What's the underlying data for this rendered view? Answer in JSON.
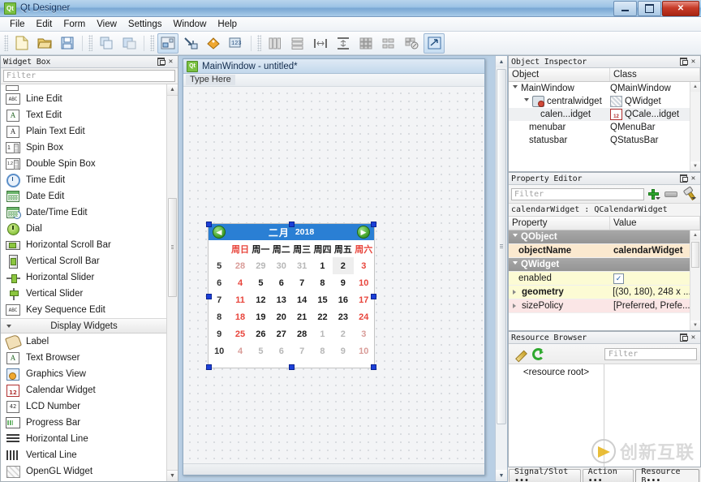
{
  "window": {
    "title": "Qt Designer",
    "logo_text": "Qt",
    "minimize_label": "",
    "maximize_label": "",
    "close_label": "✕"
  },
  "menubar": {
    "items": [
      {
        "label": "File"
      },
      {
        "label": "Edit"
      },
      {
        "label": "Form"
      },
      {
        "label": "View"
      },
      {
        "label": "Settings"
      },
      {
        "label": "Window"
      },
      {
        "label": "Help"
      }
    ]
  },
  "widget_box": {
    "title": "Widget Box",
    "filter_placeholder": "Filter",
    "items": [
      {
        "label": "Line Edit",
        "icon": "line-edit-icon"
      },
      {
        "label": "Text Edit",
        "icon": "text-edit-icon"
      },
      {
        "label": "Plain Text Edit",
        "icon": "plain-text-edit-icon"
      },
      {
        "label": "Spin Box",
        "icon": "spin-box-icon"
      },
      {
        "label": "Double Spin Box",
        "icon": "double-spin-box-icon"
      },
      {
        "label": "Time Edit",
        "icon": "time-edit-icon"
      },
      {
        "label": "Date Edit",
        "icon": "date-edit-icon"
      },
      {
        "label": "Date/Time Edit",
        "icon": "date-time-edit-icon"
      },
      {
        "label": "Dial",
        "icon": "dial-icon"
      },
      {
        "label": "Horizontal Scroll Bar",
        "icon": "horizontal-scroll-bar-icon"
      },
      {
        "label": "Vertical Scroll Bar",
        "icon": "vertical-scroll-bar-icon"
      },
      {
        "label": "Horizontal Slider",
        "icon": "horizontal-slider-icon"
      },
      {
        "label": "Vertical Slider",
        "icon": "vertical-slider-icon"
      },
      {
        "label": "Key Sequence Edit",
        "icon": "key-sequence-edit-icon"
      }
    ],
    "category": "Display Widgets",
    "display_items": [
      {
        "label": "Label",
        "icon": "label-icon"
      },
      {
        "label": "Text Browser",
        "icon": "text-browser-icon"
      },
      {
        "label": "Graphics View",
        "icon": "graphics-view-icon"
      },
      {
        "label": "Calendar Widget",
        "icon": "calendar-widget-icon"
      },
      {
        "label": "LCD Number",
        "icon": "lcd-number-icon"
      },
      {
        "label": "Progress Bar",
        "icon": "progress-bar-icon"
      },
      {
        "label": "Horizontal Line",
        "icon": "horizontal-line-icon"
      },
      {
        "label": "Vertical Line",
        "icon": "vertical-line-icon"
      },
      {
        "label": "OpenGL Widget",
        "icon": "opengl-widget-icon"
      }
    ],
    "icon_captions": {
      "line_edit": "ABC",
      "text_edit": "A",
      "plain_text_edit": "A",
      "spin_box": "1",
      "double_spin": "1.2",
      "key_seq": "ABC",
      "calendar": "12",
      "lcd": "42"
    }
  },
  "form": {
    "title": "MainWindow - untitled*",
    "logo_text": "Qt",
    "menu_placeholder": "Type Here"
  },
  "calendar": {
    "month": "二月",
    "year": "2018",
    "prev_label": "◀",
    "next_label": "▶",
    "weekdays": [
      "周日",
      "周一",
      "周二",
      "周三",
      "周四",
      "周五",
      "周六"
    ],
    "week_numbers": [
      "5",
      "6",
      "7",
      "8",
      "9",
      "10"
    ],
    "rows": [
      [
        {
          "d": "28",
          "s": "off"
        },
        {
          "d": "29",
          "s": "off"
        },
        {
          "d": "30",
          "s": "off"
        },
        {
          "d": "31",
          "s": "off"
        },
        {
          "d": "1",
          "s": ""
        },
        {
          "d": "2",
          "s": "sel"
        },
        {
          "d": "3",
          "s": "red"
        }
      ],
      [
        {
          "d": "4",
          "s": "red"
        },
        {
          "d": "5",
          "s": ""
        },
        {
          "d": "6",
          "s": ""
        },
        {
          "d": "7",
          "s": ""
        },
        {
          "d": "8",
          "s": ""
        },
        {
          "d": "9",
          "s": ""
        },
        {
          "d": "10",
          "s": "red"
        }
      ],
      [
        {
          "d": "11",
          "s": "red"
        },
        {
          "d": "12",
          "s": ""
        },
        {
          "d": "13",
          "s": ""
        },
        {
          "d": "14",
          "s": ""
        },
        {
          "d": "15",
          "s": ""
        },
        {
          "d": "16",
          "s": ""
        },
        {
          "d": "17",
          "s": "red"
        }
      ],
      [
        {
          "d": "18",
          "s": "red"
        },
        {
          "d": "19",
          "s": ""
        },
        {
          "d": "20",
          "s": ""
        },
        {
          "d": "21",
          "s": ""
        },
        {
          "d": "22",
          "s": ""
        },
        {
          "d": "23",
          "s": ""
        },
        {
          "d": "24",
          "s": "red"
        }
      ],
      [
        {
          "d": "25",
          "s": "red"
        },
        {
          "d": "26",
          "s": ""
        },
        {
          "d": "27",
          "s": ""
        },
        {
          "d": "28",
          "s": ""
        },
        {
          "d": "1",
          "s": "off"
        },
        {
          "d": "2",
          "s": "off"
        },
        {
          "d": "3",
          "s": "off"
        }
      ],
      [
        {
          "d": "4",
          "s": "off"
        },
        {
          "d": "5",
          "s": "off"
        },
        {
          "d": "6",
          "s": "off"
        },
        {
          "d": "7",
          "s": "off"
        },
        {
          "d": "8",
          "s": "off"
        },
        {
          "d": "9",
          "s": "off"
        },
        {
          "d": "10",
          "s": "off"
        }
      ]
    ],
    "header_bg": "#2a7fd4",
    "weekend_color": "#e8453c"
  },
  "object_inspector": {
    "title": "Object Inspector",
    "columns": [
      "Object",
      "Class"
    ],
    "rows": [
      {
        "object": "MainWindow",
        "class": "QMainWindow",
        "indent": 0,
        "expander": true,
        "icon": null,
        "class_icon": null,
        "selected": false
      },
      {
        "object": "centralwidget",
        "class": "QWidget",
        "indent": 1,
        "expander": true,
        "icon": "centralwidget-icon",
        "class_icon": "widget-icon",
        "selected": false
      },
      {
        "object": "calen...idget",
        "class": "QCale...idget",
        "indent": 2,
        "expander": false,
        "icon": null,
        "class_icon": "calendar-icon",
        "selected": true
      },
      {
        "object": "menubar",
        "class": "QMenuBar",
        "indent": 1,
        "expander": false,
        "icon": null,
        "class_icon": null,
        "selected": false
      },
      {
        "object": "statusbar",
        "class": "QStatusBar",
        "indent": 1,
        "expander": false,
        "icon": null,
        "class_icon": null,
        "selected": false
      }
    ]
  },
  "property_editor": {
    "title": "Property Editor",
    "filter_placeholder": "Filter",
    "subject": "calendarWidget : QCalendarWidget",
    "columns": [
      "Property",
      "Value"
    ],
    "rows": [
      {
        "name": "QObject",
        "value": "",
        "kind": "group",
        "expander": "down"
      },
      {
        "name": "objectName",
        "value": "calendarWidget",
        "kind": "orange",
        "expander": "none"
      },
      {
        "name": "QWidget",
        "value": "",
        "kind": "group",
        "expander": "down"
      },
      {
        "name": "enabled",
        "value": "",
        "kind": "yellow",
        "expander": "none",
        "checkbox": true
      },
      {
        "name": "geometry",
        "value": "[(30, 180), 248 x ...",
        "kind": "yellow",
        "expander": "right",
        "bold": true
      },
      {
        "name": "sizePolicy",
        "value": "[Preferred, Prefe...",
        "kind": "pink",
        "expander": "right"
      }
    ],
    "add_button": "plus-icon",
    "remove_button": "minus-icon",
    "config_button": "wrench-icon"
  },
  "resource_browser": {
    "title": "Resource Browser",
    "edit_button": "pencil-icon",
    "reload_button": "refresh-icon",
    "filter_placeholder": "Filter",
    "root_label": "<resource root>"
  },
  "bottom_tabs": [
    {
      "label": "Signal/Slot ∙∙∙",
      "active": false
    },
    {
      "label": "Action ∙∙∙",
      "active": false
    },
    {
      "label": "Resource B∙∙∙",
      "active": true
    }
  ],
  "watermark": {
    "text": "创新互联"
  },
  "dock_controls": {
    "float": "▣",
    "close": "✕"
  },
  "scroll": {
    "up": "▲",
    "down": "▼"
  }
}
